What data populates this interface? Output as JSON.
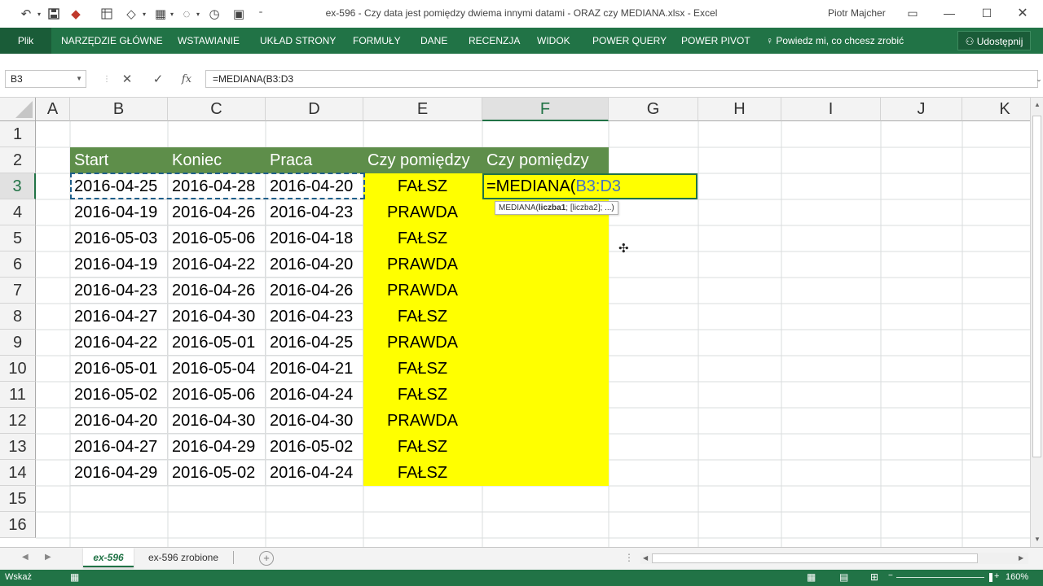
{
  "window": {
    "title": "ex-596 - Czy data jest pomiędzy dwiema innymi datami - ORAZ czy MEDIANA.xlsx - Excel",
    "user": "Piotr Majcher"
  },
  "qat_icons": [
    "undo-icon",
    "save-icon",
    "eraser-icon",
    "table-icon",
    "fill-icon",
    "border-icon",
    "shape-icon",
    "clock-icon",
    "screen-icon",
    "customize-icon"
  ],
  "ribbon": {
    "file": "Plik",
    "tabs": [
      "NARZĘDZIE GŁÓWNE",
      "WSTAWIANIE",
      "UKŁAD STRONY",
      "FORMUŁY",
      "DANE",
      "RECENZJA",
      "WIDOK",
      "POWER QUERY",
      "POWER PIVOT"
    ],
    "tell_me": "Powiedz mi, co chcesz zrobić",
    "share": "Udostępnij"
  },
  "formula_bar": {
    "name_box": "B3",
    "formula": "=MEDIANA(B3:D3",
    "fx": "fx"
  },
  "columns": [
    "A",
    "B",
    "C",
    "D",
    "E",
    "F",
    "G",
    "H",
    "I",
    "J",
    "K"
  ],
  "rows": [
    "1",
    "2",
    "3",
    "4",
    "5",
    "6",
    "7",
    "8",
    "9",
    "10",
    "11",
    "12",
    "13",
    "14",
    "15",
    "16"
  ],
  "headers": {
    "start": "Start",
    "end": "Koniec",
    "work": "Praca",
    "between1": "Czy pomiędzy",
    "between2": "Czy pomiędzy"
  },
  "table": [
    {
      "start": "2016-04-25",
      "end": "2016-04-28",
      "work": "2016-04-20",
      "result": "FAŁSZ"
    },
    {
      "start": "2016-04-19",
      "end": "2016-04-26",
      "work": "2016-04-23",
      "result": "PRAWDA"
    },
    {
      "start": "2016-05-03",
      "end": "2016-05-06",
      "work": "2016-04-18",
      "result": "FAŁSZ"
    },
    {
      "start": "2016-04-19",
      "end": "2016-04-22",
      "work": "2016-04-20",
      "result": "PRAWDA"
    },
    {
      "start": "2016-04-23",
      "end": "2016-04-26",
      "work": "2016-04-26",
      "result": "PRAWDA"
    },
    {
      "start": "2016-04-27",
      "end": "2016-04-30",
      "work": "2016-04-23",
      "result": "FAŁSZ"
    },
    {
      "start": "2016-04-22",
      "end": "2016-05-01",
      "work": "2016-04-25",
      "result": "PRAWDA"
    },
    {
      "start": "2016-05-01",
      "end": "2016-05-04",
      "work": "2016-04-21",
      "result": "FAŁSZ"
    },
    {
      "start": "2016-05-02",
      "end": "2016-05-06",
      "work": "2016-04-24",
      "result": "FAŁSZ"
    },
    {
      "start": "2016-04-20",
      "end": "2016-04-30",
      "work": "2016-04-30",
      "result": "PRAWDA"
    },
    {
      "start": "2016-04-27",
      "end": "2016-04-29",
      "work": "2016-05-02",
      "result": "FAŁSZ"
    },
    {
      "start": "2016-04-29",
      "end": "2016-05-02",
      "work": "2016-04-24",
      "result": "FAŁSZ"
    }
  ],
  "active_cell": {
    "prefix": "=MEDIANA(",
    "range": "B3:D3",
    "tooltip_fn": "MEDIANA(",
    "tooltip_arg": "liczba1",
    "tooltip_rest": "; [liczba2]; ...)"
  },
  "sheets": [
    "ex-596",
    "ex-596 zrobione"
  ],
  "status": {
    "mode": "Wskaż",
    "zoom": "160%"
  },
  "colors": {
    "excel_green": "#217346",
    "header_fill": "#5e8e4a",
    "highlight": "#ffff00",
    "range_ref": "#4472c4"
  }
}
